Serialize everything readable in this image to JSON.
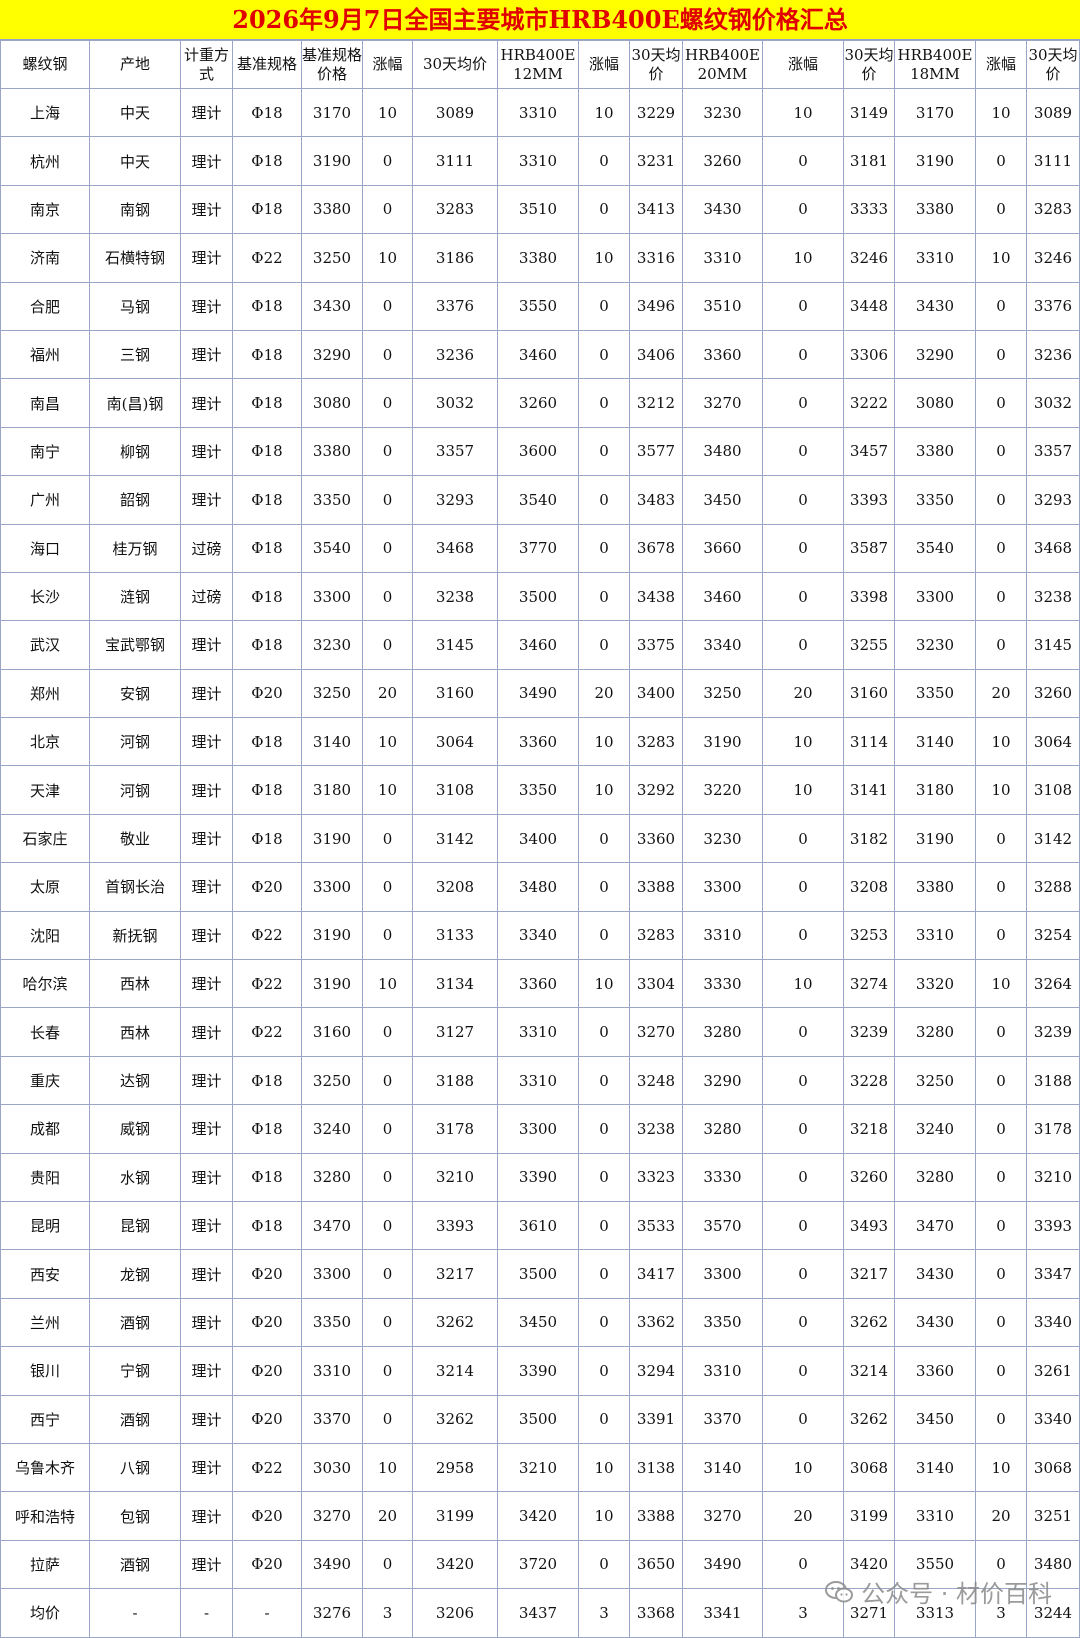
{
  "title": "2026年9月7日全国主要城市HRB400E螺纹钢价格汇总",
  "headers": [
    "螺纹钢",
    "产地",
    "计重方式",
    "基准规格",
    "基准规格价格",
    "涨幅",
    "30天均价",
    "HRB400E 12MM",
    "涨幅",
    "30天均价",
    "HRB400E 20MM",
    "涨幅",
    "30天均价",
    "HRB400E 18MM",
    "涨幅",
    "30天均价"
  ],
  "rows": [
    [
      "上海",
      "中天",
      "理计",
      "Φ18",
      "3170",
      "10",
      "3089",
      "3310",
      "10",
      "3229",
      "3230",
      "10",
      "3149",
      "3170",
      "10",
      "3089"
    ],
    [
      "杭州",
      "中天",
      "理计",
      "Φ18",
      "3190",
      "0",
      "3111",
      "3310",
      "0",
      "3231",
      "3260",
      "0",
      "3181",
      "3190",
      "0",
      "3111"
    ],
    [
      "南京",
      "南钢",
      "理计",
      "Φ18",
      "3380",
      "0",
      "3283",
      "3510",
      "0",
      "3413",
      "3430",
      "0",
      "3333",
      "3380",
      "0",
      "3283"
    ],
    [
      "济南",
      "石横特钢",
      "理计",
      "Φ22",
      "3250",
      "10",
      "3186",
      "3380",
      "10",
      "3316",
      "3310",
      "10",
      "3246",
      "3310",
      "10",
      "3246"
    ],
    [
      "合肥",
      "马钢",
      "理计",
      "Φ18",
      "3430",
      "0",
      "3376",
      "3550",
      "0",
      "3496",
      "3510",
      "0",
      "3448",
      "3430",
      "0",
      "3376"
    ],
    [
      "福州",
      "三钢",
      "理计",
      "Φ18",
      "3290",
      "0",
      "3236",
      "3460",
      "0",
      "3406",
      "3360",
      "0",
      "3306",
      "3290",
      "0",
      "3236"
    ],
    [
      "南昌",
      "南(昌)钢",
      "理计",
      "Φ18",
      "3080",
      "0",
      "3032",
      "3260",
      "0",
      "3212",
      "3270",
      "0",
      "3222",
      "3080",
      "0",
      "3032"
    ],
    [
      "南宁",
      "柳钢",
      "理计",
      "Φ18",
      "3380",
      "0",
      "3357",
      "3600",
      "0",
      "3577",
      "3480",
      "0",
      "3457",
      "3380",
      "0",
      "3357"
    ],
    [
      "广州",
      "韶钢",
      "理计",
      "Φ18",
      "3350",
      "0",
      "3293",
      "3540",
      "0",
      "3483",
      "3450",
      "0",
      "3393",
      "3350",
      "0",
      "3293"
    ],
    [
      "海口",
      "桂万钢",
      "过磅",
      "Φ18",
      "3540",
      "0",
      "3468",
      "3770",
      "0",
      "3678",
      "3660",
      "0",
      "3587",
      "3540",
      "0",
      "3468"
    ],
    [
      "长沙",
      "涟钢",
      "过磅",
      "Φ18",
      "3300",
      "0",
      "3238",
      "3500",
      "0",
      "3438",
      "3460",
      "0",
      "3398",
      "3300",
      "0",
      "3238"
    ],
    [
      "武汉",
      "宝武鄂钢",
      "理计",
      "Φ18",
      "3230",
      "0",
      "3145",
      "3460",
      "0",
      "3375",
      "3340",
      "0",
      "3255",
      "3230",
      "0",
      "3145"
    ],
    [
      "郑州",
      "安钢",
      "理计",
      "Φ20",
      "3250",
      "20",
      "3160",
      "3490",
      "20",
      "3400",
      "3250",
      "20",
      "3160",
      "3350",
      "20",
      "3260"
    ],
    [
      "北京",
      "河钢",
      "理计",
      "Φ18",
      "3140",
      "10",
      "3064",
      "3360",
      "10",
      "3283",
      "3190",
      "10",
      "3114",
      "3140",
      "10",
      "3064"
    ],
    [
      "天津",
      "河钢",
      "理计",
      "Φ18",
      "3180",
      "10",
      "3108",
      "3350",
      "10",
      "3292",
      "3220",
      "10",
      "3141",
      "3180",
      "10",
      "3108"
    ],
    [
      "石家庄",
      "敬业",
      "理计",
      "Φ18",
      "3190",
      "0",
      "3142",
      "3400",
      "0",
      "3360",
      "3230",
      "0",
      "3182",
      "3190",
      "0",
      "3142"
    ],
    [
      "太原",
      "首钢长治",
      "理计",
      "Φ20",
      "3300",
      "0",
      "3208",
      "3480",
      "0",
      "3388",
      "3300",
      "0",
      "3208",
      "3380",
      "0",
      "3288"
    ],
    [
      "沈阳",
      "新抚钢",
      "理计",
      "Φ22",
      "3190",
      "0",
      "3133",
      "3340",
      "0",
      "3283",
      "3310",
      "0",
      "3253",
      "3310",
      "0",
      "3254"
    ],
    [
      "哈尔滨",
      "西林",
      "理计",
      "Φ22",
      "3190",
      "10",
      "3134",
      "3360",
      "10",
      "3304",
      "3330",
      "10",
      "3274",
      "3320",
      "10",
      "3264"
    ],
    [
      "长春",
      "西林",
      "理计",
      "Φ22",
      "3160",
      "0",
      "3127",
      "3310",
      "0",
      "3270",
      "3280",
      "0",
      "3239",
      "3280",
      "0",
      "3239"
    ],
    [
      "重庆",
      "达钢",
      "理计",
      "Φ18",
      "3250",
      "0",
      "3188",
      "3310",
      "0",
      "3248",
      "3290",
      "0",
      "3228",
      "3250",
      "0",
      "3188"
    ],
    [
      "成都",
      "威钢",
      "理计",
      "Φ18",
      "3240",
      "0",
      "3178",
      "3300",
      "0",
      "3238",
      "3280",
      "0",
      "3218",
      "3240",
      "0",
      "3178"
    ],
    [
      "贵阳",
      "水钢",
      "理计",
      "Φ18",
      "3280",
      "0",
      "3210",
      "3390",
      "0",
      "3323",
      "3330",
      "0",
      "3260",
      "3280",
      "0",
      "3210"
    ],
    [
      "昆明",
      "昆钢",
      "理计",
      "Φ18",
      "3470",
      "0",
      "3393",
      "3610",
      "0",
      "3533",
      "3570",
      "0",
      "3493",
      "3470",
      "0",
      "3393"
    ],
    [
      "西安",
      "龙钢",
      "理计",
      "Φ20",
      "3300",
      "0",
      "3217",
      "3500",
      "0",
      "3417",
      "3300",
      "0",
      "3217",
      "3430",
      "0",
      "3347"
    ],
    [
      "兰州",
      "酒钢",
      "理计",
      "Φ20",
      "3350",
      "0",
      "3262",
      "3450",
      "0",
      "3362",
      "3350",
      "0",
      "3262",
      "3430",
      "0",
      "3340"
    ],
    [
      "银川",
      "宁钢",
      "理计",
      "Φ20",
      "3310",
      "0",
      "3214",
      "3390",
      "0",
      "3294",
      "3310",
      "0",
      "3214",
      "3360",
      "0",
      "3261"
    ],
    [
      "西宁",
      "酒钢",
      "理计",
      "Φ20",
      "3370",
      "0",
      "3262",
      "3500",
      "0",
      "3391",
      "3370",
      "0",
      "3262",
      "3450",
      "0",
      "3340"
    ],
    [
      "乌鲁木齐",
      "八钢",
      "理计",
      "Φ22",
      "3030",
      "10",
      "2958",
      "3210",
      "10",
      "3138",
      "3140",
      "10",
      "3068",
      "3140",
      "10",
      "3068"
    ],
    [
      "呼和浩特",
      "包钢",
      "理计",
      "Φ20",
      "3270",
      "20",
      "3199",
      "3420",
      "10",
      "3388",
      "3270",
      "20",
      "3199",
      "3310",
      "20",
      "3251"
    ],
    [
      "拉萨",
      "酒钢",
      "理计",
      "Φ20",
      "3490",
      "0",
      "3420",
      "3720",
      "0",
      "3650",
      "3490",
      "0",
      "3420",
      "3550",
      "0",
      "3480"
    ],
    [
      "均价",
      "-",
      "-",
      "-",
      "3276",
      "3",
      "3206",
      "3437",
      "3",
      "3368",
      "3341",
      "3",
      "3271",
      "3313",
      "3",
      "3244"
    ]
  ],
  "watermark": "公众号 · 材价百科",
  "watermark_icon": "wechat-icon",
  "colors": {
    "title_bg": "#ffff00",
    "title_text": "#e00000",
    "price_text": "#3d55c6",
    "grid": "#9aa6c8"
  }
}
